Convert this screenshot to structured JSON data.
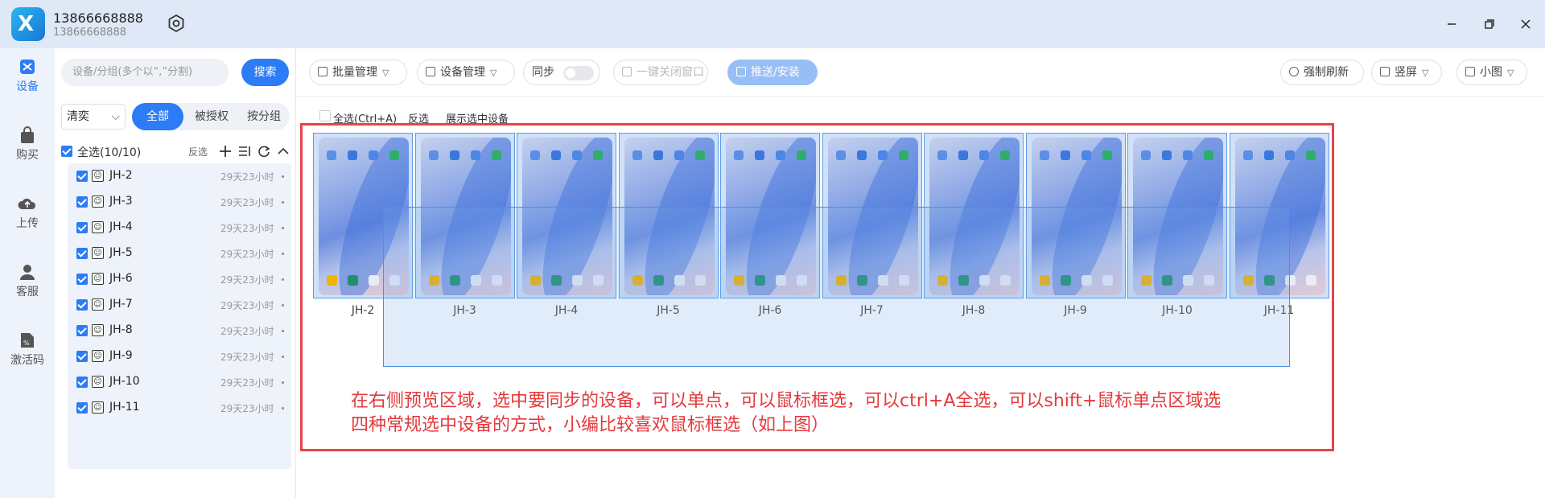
{
  "titlebar": {
    "account_name": "13866668888",
    "account_sub": "13866668888",
    "logo_letter": "X"
  },
  "rail": [
    {
      "label": "设备",
      "icon": "devices-icon",
      "active": true
    },
    {
      "label": "购买",
      "icon": "shopping-bag-icon",
      "active": false
    },
    {
      "label": "上传",
      "icon": "cloud-upload-icon",
      "active": false
    },
    {
      "label": "客服",
      "icon": "customer-service-icon",
      "active": false
    },
    {
      "label": "激活码",
      "icon": "activation-code-icon",
      "active": false
    }
  ],
  "device_panel": {
    "search_placeholder": "设备/分组(多个以“,”分割)",
    "search_button": "搜索",
    "quality_select": "清奕",
    "tabs": [
      "全部",
      "被授权",
      "按分组"
    ],
    "select_all_label": "全选(10/10)",
    "invert_label": "反选",
    "devices": [
      {
        "name": "JH-2",
        "time": "29天23小时"
      },
      {
        "name": "JH-3",
        "time": "29天23小时"
      },
      {
        "name": "JH-4",
        "time": "29天23小时"
      },
      {
        "name": "JH-5",
        "time": "29天23小时"
      },
      {
        "name": "JH-6",
        "time": "29天23小时"
      },
      {
        "name": "JH-7",
        "time": "29天23小时"
      },
      {
        "name": "JH-8",
        "time": "29天23小时"
      },
      {
        "name": "JH-9",
        "time": "29天23小时"
      },
      {
        "name": "JH-10",
        "time": "29天23小时"
      },
      {
        "name": "JH-11",
        "time": "29天23小时"
      }
    ]
  },
  "toolbar": {
    "batch_manage": "批量管理",
    "device_manage": "设备管理",
    "sync_label": "同步",
    "sync_on": false,
    "close_windows": "一键关闭窗口",
    "push_install": "推送/安装",
    "force_refresh": "强制刷新",
    "orientation": "竖屏",
    "view_size": "小图"
  },
  "preview": {
    "select_all": "全选(Ctrl+A)",
    "invert": "反选",
    "show_selected": "展示选中设备",
    "devices": [
      "JH-2",
      "JH-3",
      "JH-4",
      "JH-5",
      "JH-6",
      "JH-7",
      "JH-8",
      "JH-9",
      "JH-10",
      "JH-11"
    ]
  },
  "annotation": {
    "line1": "在右侧预览区域，选中要同步的设备，可以单点，可以鼠标框选，可以ctrl+A全选，可以shift+鼠标单点区域选",
    "line2": "四种常规选中设备的方式，小编比较喜欢鼠标框选（如上图）"
  },
  "colors": {
    "accent": "#2b7cf6",
    "annotation_red": "#e4393c",
    "titlebar_bg": "#dfe8f7"
  }
}
